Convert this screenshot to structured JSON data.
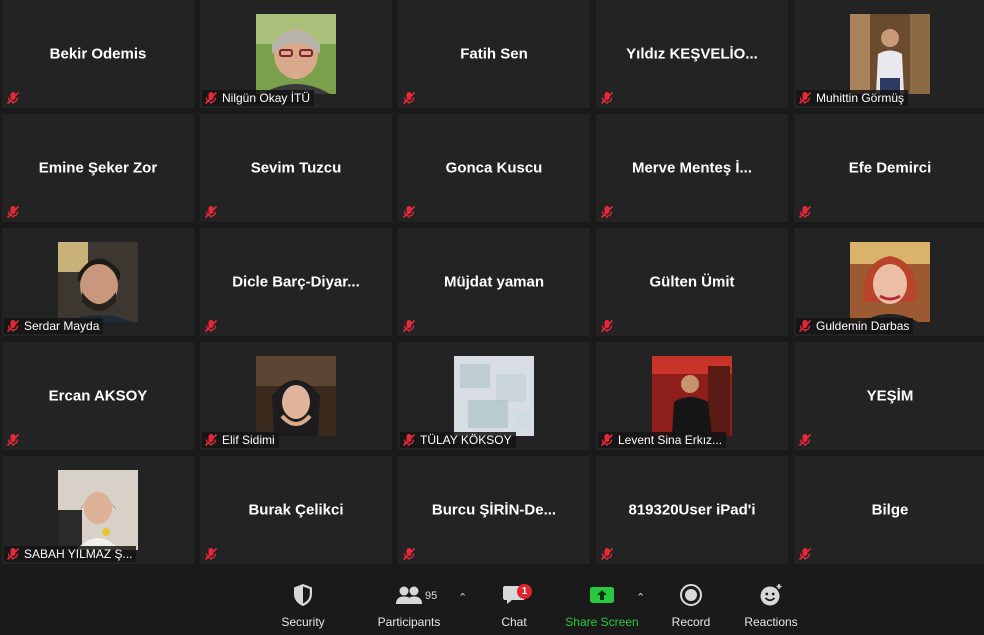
{
  "participants_grid": [
    {
      "name": "Bekir Odemis",
      "type": "text"
    },
    {
      "name": "Nilgün Okay İTÜ",
      "type": "photo",
      "photo": "woman-glasses"
    },
    {
      "name": "Fatih Sen",
      "type": "text"
    },
    {
      "name": "Yıldız  KEŞVELİO...",
      "type": "text"
    },
    {
      "name": "Muhittin Görmüş",
      "type": "photo",
      "photo": "man-shop"
    },
    {
      "name": "Emine Şeker Zor",
      "type": "text"
    },
    {
      "name": "Sevim Tuzcu",
      "type": "text"
    },
    {
      "name": "Gonca Kuscu",
      "type": "text"
    },
    {
      "name": "Merve Menteş  İ...",
      "type": "text"
    },
    {
      "name": "Efe Demirci",
      "type": "text"
    },
    {
      "name": "Serdar Mayda",
      "type": "photo",
      "photo": "man-beard"
    },
    {
      "name": "Dicle  Barç-Diyar...",
      "type": "text"
    },
    {
      "name": "Müjdat yaman",
      "type": "text"
    },
    {
      "name": "Gülten Ümit",
      "type": "text"
    },
    {
      "name": "Guldemin Darbas",
      "type": "photo",
      "photo": "woman-red-hair"
    },
    {
      "name": "Ercan AKSOY",
      "type": "text"
    },
    {
      "name": "Elif Sidimi",
      "type": "photo",
      "photo": "woman-hijab"
    },
    {
      "name": "TÜLAY KÖKSOY",
      "type": "photo",
      "photo": "blurred"
    },
    {
      "name": "Levent Sina Erkız...",
      "type": "photo",
      "photo": "man-red-room"
    },
    {
      "name": "YEŞİM",
      "type": "text"
    },
    {
      "name": "SABAH YILMAZ Ş...",
      "type": "photo",
      "photo": "woman-flower"
    },
    {
      "name": "Burak Çelikci",
      "type": "text"
    },
    {
      "name": "Burcu  ŞİRİN-De...",
      "type": "text"
    },
    {
      "name": "819320User iPad'i",
      "type": "text"
    },
    {
      "name": "Bilge",
      "type": "text"
    }
  ],
  "toolbar": {
    "security": {
      "label": "Security",
      "icon": "shield-icon"
    },
    "participants": {
      "label": "Participants",
      "icon": "people-icon",
      "count": "95"
    },
    "chat": {
      "label": "Chat",
      "icon": "chat-bubble-icon",
      "badge": "1"
    },
    "share_screen": {
      "label": "Share Screen",
      "icon": "share-screen-icon",
      "color": "#28c840"
    },
    "record": {
      "label": "Record",
      "icon": "record-icon"
    },
    "reactions": {
      "label": "Reactions",
      "icon": "smiley-icon"
    }
  },
  "colors": {
    "mute_icon": "#e5283a",
    "tile_bg": "#232323",
    "bg": "#1a1a1a"
  }
}
